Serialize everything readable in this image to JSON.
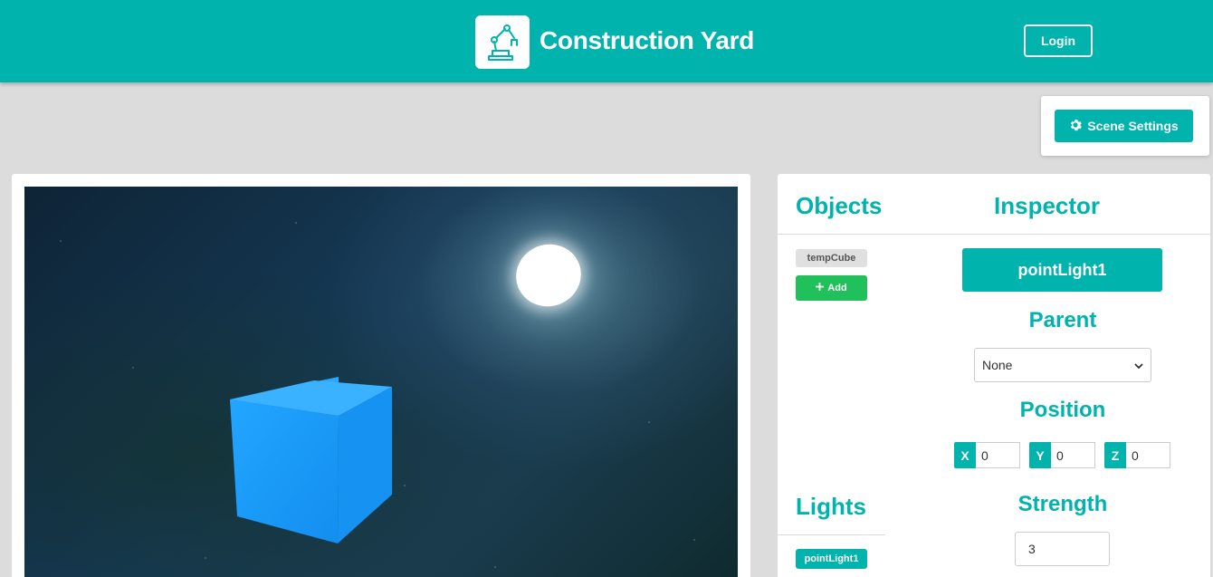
{
  "header": {
    "title": "Construction Yard",
    "login_label": "Login",
    "logo_icon": "robot-arm-icon"
  },
  "scene_settings": {
    "label": "Scene Settings",
    "icon": "gear-icon"
  },
  "objects": {
    "heading": "Objects",
    "items": [
      "tempCube"
    ],
    "add_label": "Add"
  },
  "lights": {
    "heading": "Lights",
    "items": [
      "pointLight1"
    ]
  },
  "inspector": {
    "heading": "Inspector",
    "selected": "pointLight1",
    "parent_heading": "Parent",
    "parent_value": "None",
    "position_heading": "Position",
    "position": {
      "x_label": "X",
      "x": "0",
      "y_label": "Y",
      "y": "0",
      "z_label": "Z",
      "z": "0"
    },
    "strength_heading": "Strength",
    "strength": "3"
  },
  "colors": {
    "accent": "#00b3ad",
    "add_green": "#20c05a",
    "cube_blue": "#1a9bff"
  }
}
